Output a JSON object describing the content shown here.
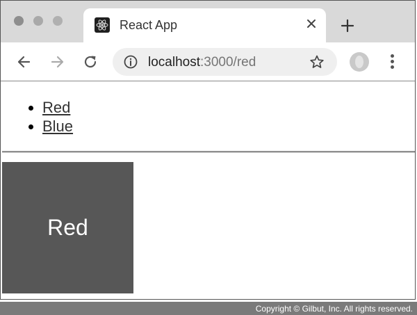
{
  "tab": {
    "title": "React App",
    "favicon": "react-icon"
  },
  "toolbar": {
    "url_host": "localhost",
    "url_path": ":3000/red"
  },
  "nav": {
    "items": [
      {
        "label": "Red"
      },
      {
        "label": "Blue"
      }
    ]
  },
  "color_box": {
    "label": "Red",
    "color": "#575757"
  },
  "footer": {
    "copyright": "Copyright © Gilbut, Inc. All rights reserved."
  }
}
